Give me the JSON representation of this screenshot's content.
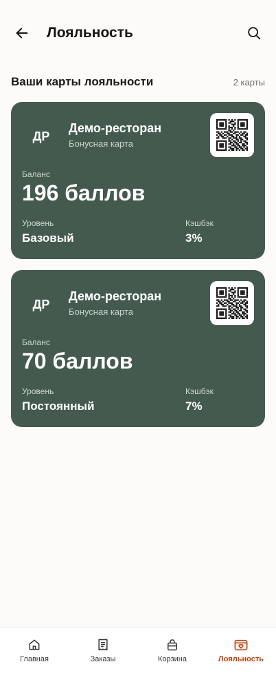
{
  "header": {
    "title": "Лояльность",
    "back_icon": "arrow-left-icon",
    "search_icon": "search-icon"
  },
  "section": {
    "title": "Ваши карты лояльности",
    "count": "2 карты"
  },
  "cards": [
    {
      "avatar": "ДР",
      "name": "Демо-ресторан",
      "type": "Бонусная карта",
      "balance_label": "Баланс",
      "balance": "196 баллов",
      "level_label": "Уровень",
      "level": "Базовый",
      "cashback_label": "Кэшбэк",
      "cashback": "3%"
    },
    {
      "avatar": "ДР",
      "name": "Демо-ресторан",
      "type": "Бонусная карта",
      "balance_label": "Баланс",
      "balance": "70 баллов",
      "level_label": "Уровень",
      "level": "Постоянный",
      "cashback_label": "Кэшбэк",
      "cashback": "7%"
    }
  ],
  "nav": {
    "items": [
      {
        "label": "Главная",
        "icon": "home-icon"
      },
      {
        "label": "Заказы",
        "icon": "receipt-icon"
      },
      {
        "label": "Корзина",
        "icon": "bag-icon"
      },
      {
        "label": "Лояльность",
        "icon": "loyalty-card-icon",
        "active": true
      }
    ]
  },
  "colors": {
    "card_bg": "#445a4f",
    "accent": "#c2410c",
    "background": "#fcfbfa"
  }
}
